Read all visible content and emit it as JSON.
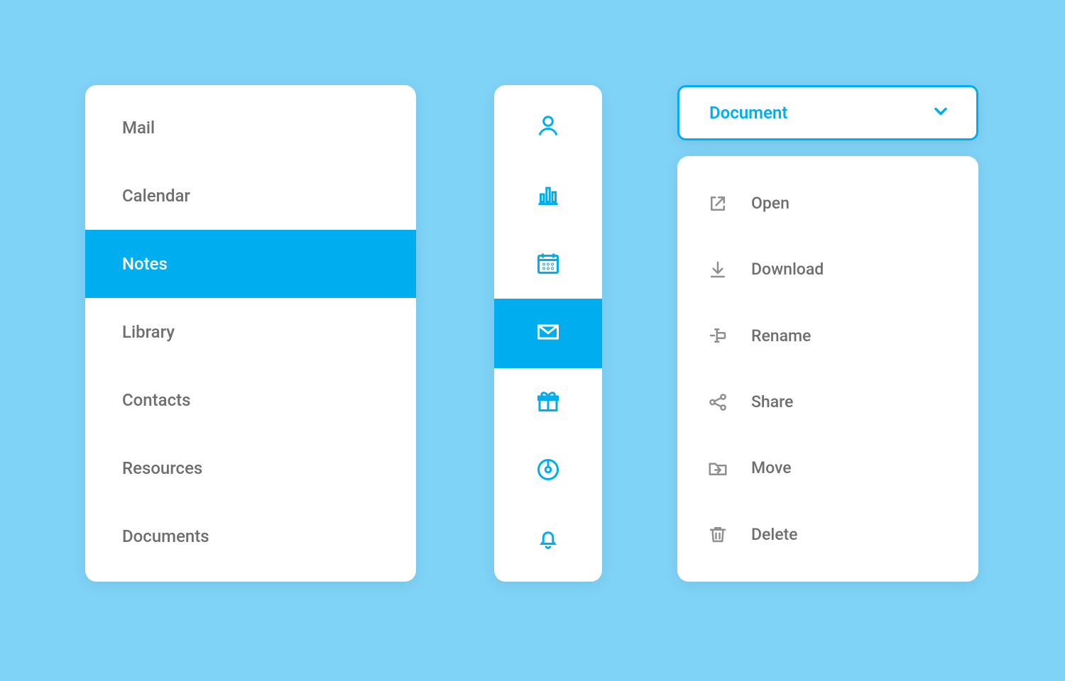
{
  "colors": {
    "accent": "#00aeef",
    "background": "#7fd3f7",
    "panel": "#ffffff",
    "text_muted": "#6e6e6e",
    "icon_muted": "#8f8f8f"
  },
  "text_menu": {
    "items": [
      {
        "label": "Mail",
        "selected": false
      },
      {
        "label": "Calendar",
        "selected": false
      },
      {
        "label": "Notes",
        "selected": true
      },
      {
        "label": "Library",
        "selected": false
      },
      {
        "label": "Contacts",
        "selected": false
      },
      {
        "label": "Resources",
        "selected": false
      },
      {
        "label": "Documents",
        "selected": false
      }
    ]
  },
  "icon_menu": {
    "items": [
      {
        "icon": "person-icon",
        "selected": false
      },
      {
        "icon": "bar-chart-icon",
        "selected": false
      },
      {
        "icon": "calendar-icon",
        "selected": false
      },
      {
        "icon": "mail-icon",
        "selected": true
      },
      {
        "icon": "gift-icon",
        "selected": false
      },
      {
        "icon": "disc-icon",
        "selected": false
      },
      {
        "icon": "bell-icon",
        "selected": false
      }
    ]
  },
  "dropdown": {
    "selected_label": "Document"
  },
  "context_menu": {
    "items": [
      {
        "icon": "open-external-icon",
        "label": "Open"
      },
      {
        "icon": "download-icon",
        "label": "Download"
      },
      {
        "icon": "rename-icon",
        "label": "Rename"
      },
      {
        "icon": "share-icon",
        "label": "Share"
      },
      {
        "icon": "move-folder-icon",
        "label": "Move"
      },
      {
        "icon": "trash-icon",
        "label": "Delete"
      }
    ]
  }
}
